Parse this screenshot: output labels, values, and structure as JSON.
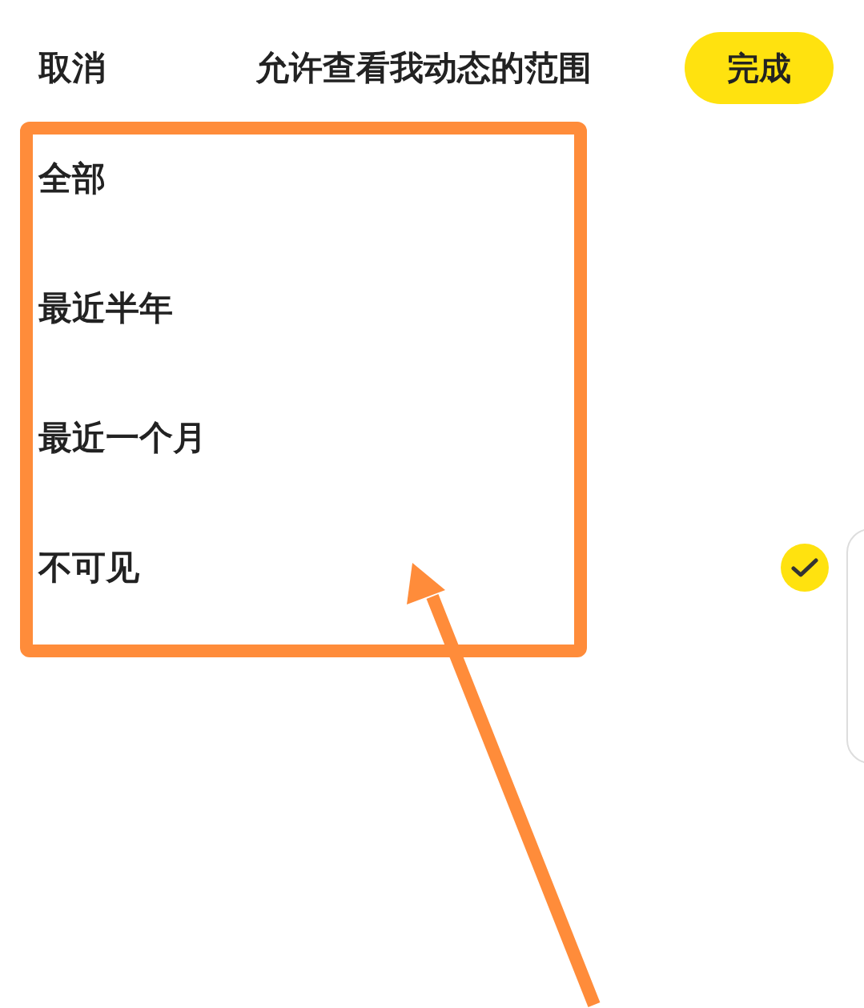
{
  "header": {
    "cancel": "取消",
    "title": "允许查看我动态的范围",
    "done": "完成"
  },
  "options": [
    {
      "label": "全部",
      "selected": false
    },
    {
      "label": "最近半年",
      "selected": false
    },
    {
      "label": "最近一个月",
      "selected": false
    },
    {
      "label": "不可见",
      "selected": true
    }
  ]
}
